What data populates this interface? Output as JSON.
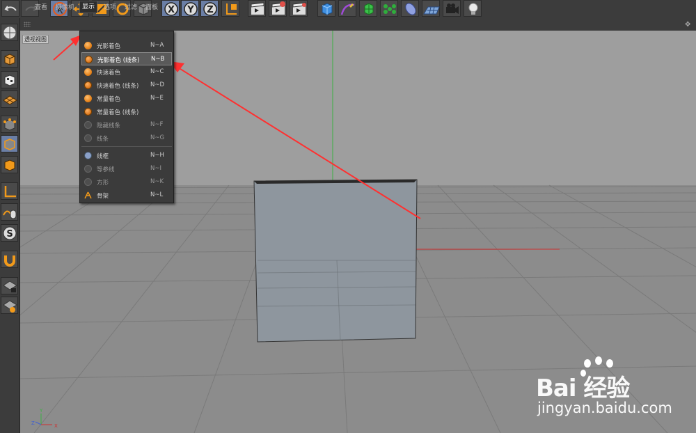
{
  "toolbar": {
    "buttons": [
      "undo-icon",
      "redo-icon",
      "select-arrow-icon",
      "move-icon",
      "scale-icon",
      "rotate-icon",
      "object-icon",
      "x-axis-icon",
      "y-axis-icon",
      "z-axis-icon",
      "world-coord-icon",
      "render-view-icon",
      "render-picture-queue-icon",
      "render-settings-icon",
      "cube-primitive-icon",
      "pen-spline-icon",
      "subdivision-icon",
      "array-icon",
      "deformer-icon",
      "floor-icon",
      "camera-icon",
      "light-icon"
    ],
    "axis_x": "X",
    "axis_y": "Y",
    "axis_z": "Z"
  },
  "viewport_menu": {
    "items": [
      "查看",
      "摄像机",
      "显示",
      "选项",
      "过滤",
      "面板"
    ],
    "active": "显示"
  },
  "viewport_label": "透视视图",
  "display_menu": {
    "items": [
      {
        "label": "光影着色",
        "shortcut": "N~A",
        "icon": "gouraud-shading-icon"
      },
      {
        "label": "光影着色 (线条)",
        "shortcut": "N~B",
        "icon": "gouraud-shading-lines-icon",
        "highlighted": true
      },
      {
        "label": "快速着色",
        "shortcut": "N~C",
        "icon": "quick-shading-icon"
      },
      {
        "label": "快速着色 (线条)",
        "shortcut": "N~D",
        "icon": "quick-shading-lines-icon"
      },
      {
        "label": "常量着色",
        "shortcut": "N~E",
        "icon": "constant-shading-icon"
      },
      {
        "label": "常量着色 (线条)",
        "shortcut": "",
        "icon": "constant-shading-lines-icon"
      },
      {
        "label": "隐藏线条",
        "shortcut": "N~F",
        "icon": "hidden-line-icon"
      },
      {
        "label": "线条",
        "shortcut": "N~G",
        "icon": "lines-icon"
      },
      {
        "label": "线框",
        "shortcut": "N~H",
        "icon": "wireframe-icon"
      },
      {
        "label": "等参线",
        "shortcut": "N~I",
        "icon": "isoparms-icon"
      },
      {
        "label": "方形",
        "shortcut": "N~K",
        "icon": "box-icon"
      },
      {
        "label": "骨架",
        "shortcut": "N~L",
        "icon": "skeleton-icon"
      }
    ]
  },
  "axis_gizmo": {
    "x": "X",
    "y": "Y",
    "z": "Z"
  },
  "watermark": {
    "brand": "Bai 经验",
    "url": "jingyan.baidu.com"
  },
  "colors": {
    "accent_orange": "#f08a1c",
    "annotation_red": "#ff3030",
    "viewport_grey": "#9c9c9c",
    "menu_bg": "#3b3b3b"
  }
}
